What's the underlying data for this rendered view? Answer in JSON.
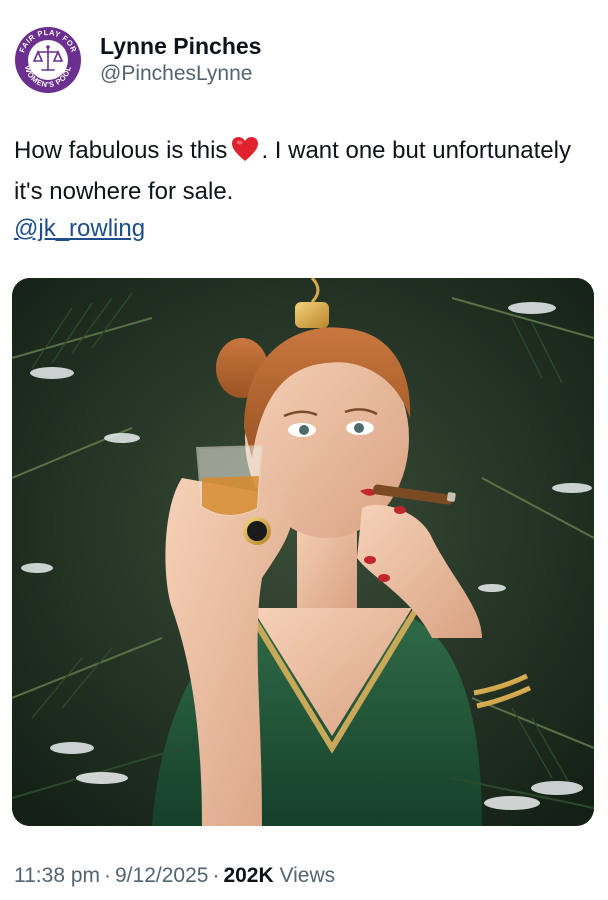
{
  "author": {
    "display_name": "Lynne Pinches",
    "handle": "@PinchesLynne",
    "avatar_label": "FAIR PLAY FOR WOMEN'S POOL"
  },
  "tweet": {
    "text_part1": "How fabulous is this",
    "text_emoji": "red-heart-icon",
    "text_part2": ".  I want one but unfortunately it's nowhere for sale.",
    "mention": "@jk_rowling"
  },
  "media": {
    "description_icon": "photo"
  },
  "meta": {
    "time": "11:38 pm",
    "date": "9/12/2025",
    "views_count": "202K",
    "views_label": "Views",
    "separator": "·"
  },
  "colors": {
    "text": "#0f1419",
    "muted": "#536471",
    "link": "#1d4e89",
    "avatar_purple": "#6b2f8f",
    "heart": "#e0212e"
  }
}
